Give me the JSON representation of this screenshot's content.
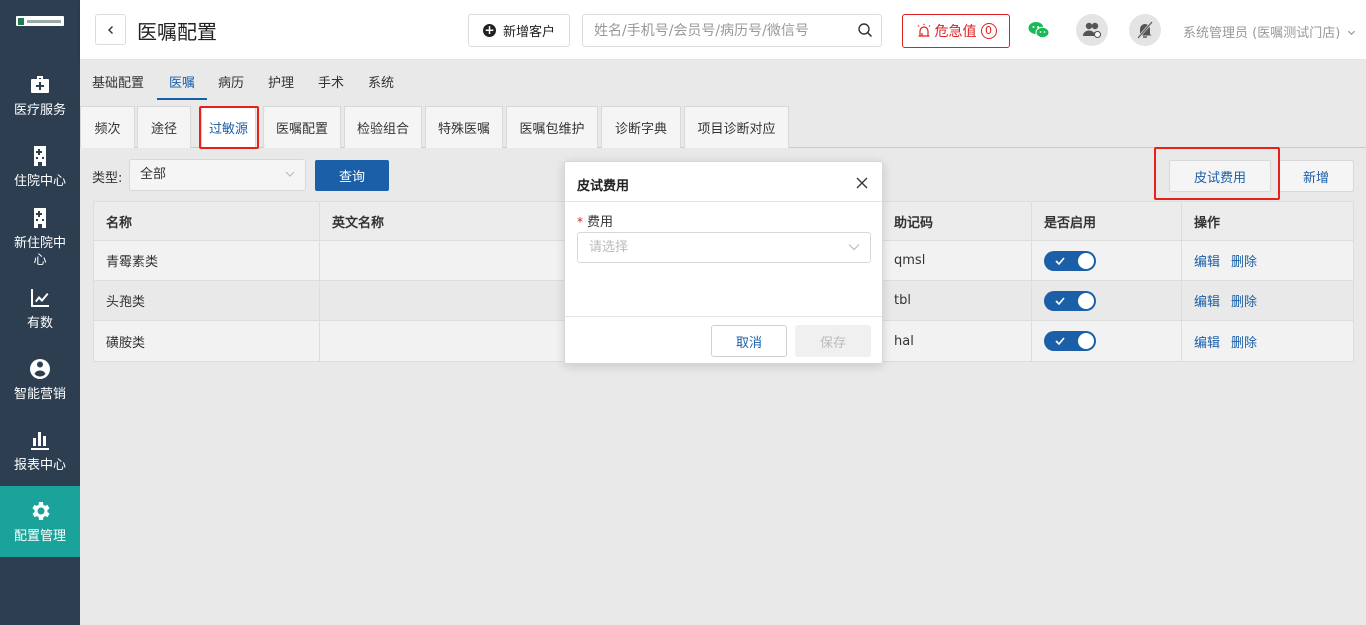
{
  "sidebar": {
    "items": [
      {
        "label": "医疗服务",
        "icon": "medical-kit-icon"
      },
      {
        "label": "住院中心",
        "icon": "hospital-building-icon"
      },
      {
        "label": "新住院中心",
        "icon": "hospital-building-icon"
      },
      {
        "label": "有数",
        "icon": "trend-chart-icon"
      },
      {
        "label": "智能营销",
        "icon": "marketing-icon"
      },
      {
        "label": "报表中心",
        "icon": "bar-chart-icon"
      },
      {
        "label": "配置管理",
        "icon": "gear-icon"
      }
    ],
    "active_color": "#1aa39a"
  },
  "header": {
    "title": "医嘱配置",
    "add_customer_label": "新增客户",
    "search_placeholder": "姓名/手机号/会员号/病历号/微信号",
    "critical_label": "危急值",
    "critical_count": "0",
    "user_label": "系统管理员 (医嘱测试门店)"
  },
  "tabs_level1": [
    "基础配置",
    "医嘱",
    "病历",
    "护理",
    "手术",
    "系统"
  ],
  "tabs_level2": [
    "频次",
    "途径",
    "过敏源",
    "医嘱配置",
    "检验组合",
    "特殊医嘱",
    "医嘱包维护",
    "诊断字典",
    "项目诊断对应"
  ],
  "filter": {
    "type_label": "类型:",
    "type_value": "全部",
    "query_label": "查询",
    "skin_test_fee_label": "皮试费用",
    "new_label": "新增"
  },
  "table": {
    "columns": [
      "名称",
      "英文名称",
      "",
      "助记码",
      "是否启用",
      "操作"
    ],
    "rows": [
      {
        "name": "青霉素类",
        "english": "",
        "mnemonic": "qmsl",
        "enabled": true
      },
      {
        "name": "头孢类",
        "english": "",
        "mnemonic": "tbl",
        "enabled": true
      },
      {
        "name": "磺胺类",
        "english": "",
        "mnemonic": "hal",
        "enabled": true
      }
    ],
    "edit_label": "编辑",
    "delete_label": "删除"
  },
  "modal": {
    "title": "皮试费用",
    "required_mark": "*",
    "field_label": "费用",
    "field_placeholder": "请选择",
    "cancel_label": "取消",
    "save_label": "保存"
  },
  "colors": {
    "primary": "#1a5fa8",
    "danger": "#e02020",
    "sidebar": "#2c3e50"
  }
}
